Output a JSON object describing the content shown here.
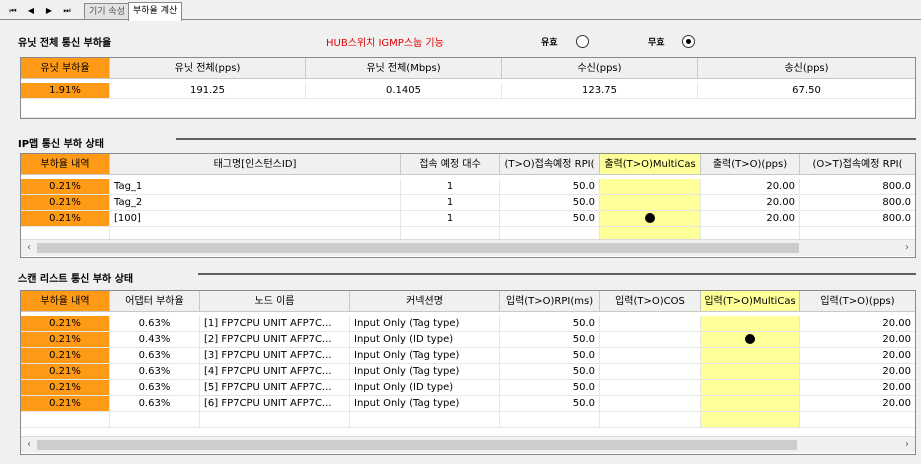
{
  "tabs": {
    "nav_first": "⏮",
    "nav_prev": "◀",
    "nav_next": "▶",
    "nav_last": "⏭",
    "items": [
      {
        "label": "기기 속성"
      },
      {
        "label": "부하율 계산"
      }
    ]
  },
  "unit": {
    "title": "유닛 전체 통신 부하율",
    "hub_label": "HUB스위치 IGMP스눕 기능",
    "opt_valid": "유효",
    "opt_invalid": "무효",
    "selected": "무효",
    "headers": [
      "유닛 부하율",
      "유닛 전체(pps)",
      "유닛 전체(Mbps)",
      "수신(pps)",
      "송신(pps)"
    ],
    "row": [
      "1.91%",
      "191.25",
      "0.1405",
      "123.75",
      "67.50"
    ]
  },
  "ip": {
    "title": "IP맵 통신 부하 상태",
    "headers": [
      "부하율 내역",
      "태그명[인스턴스ID]",
      "접속 예정 대수",
      "(T>O)접속예정 RPI(",
      "출력(T>O)MultiCas",
      "출력(T>O)(pps)",
      "(O>T)접속예정 RPI("
    ],
    "rows": [
      [
        "0.21%",
        "Tag_1",
        "1",
        "50.0",
        "",
        "20.00",
        "800.0"
      ],
      [
        "0.21%",
        "Tag_2",
        "1",
        "50.0",
        "",
        "20.00",
        "800.0"
      ],
      [
        "0.21%",
        "[100]",
        "1",
        "50.0",
        "●",
        "20.00",
        "800.0"
      ]
    ]
  },
  "scan": {
    "title": "스캔 리스트 통신 부하 상태",
    "headers": [
      "부하율 내역",
      "어댑터 부하율",
      "노드 이름",
      "커넥션명",
      "입력(T>O)RPI(ms)",
      "입력(T>O)COS",
      "입력(T>O)MultiCas",
      "입력(T>O)(pps)"
    ],
    "rows": [
      [
        "0.21%",
        "0.63%",
        "[1] FP7CPU UNIT AFP7C...",
        "Input Only (Tag type)",
        "50.0",
        "",
        "",
        "20.00"
      ],
      [
        "0.21%",
        "0.43%",
        "[2] FP7CPU UNIT AFP7C...",
        "Input Only (ID type)",
        "50.0",
        "",
        "●",
        "20.00"
      ],
      [
        "0.21%",
        "0.63%",
        "[3] FP7CPU UNIT AFP7C...",
        "Input Only (Tag type)",
        "50.0",
        "",
        "",
        "20.00"
      ],
      [
        "0.21%",
        "0.63%",
        "[4] FP7CPU UNIT AFP7C...",
        "Input Only (Tag type)",
        "50.0",
        "",
        "",
        "20.00"
      ],
      [
        "0.21%",
        "0.63%",
        "[5] FP7CPU UNIT AFP7C...",
        "Input Only (ID type)",
        "50.0",
        "",
        "",
        "20.00"
      ],
      [
        "0.21%",
        "0.63%",
        "[6] FP7CPU UNIT AFP7C...",
        "Input Only (Tag type)",
        "50.0",
        "",
        "",
        "20.00"
      ]
    ]
  },
  "icons": {
    "scroll_left": "‹",
    "scroll_right": "›"
  },
  "colors": {
    "accent_orange": "#ff9a17",
    "highlight_yellow": "#ffff99",
    "hub_red": "#e00000"
  }
}
